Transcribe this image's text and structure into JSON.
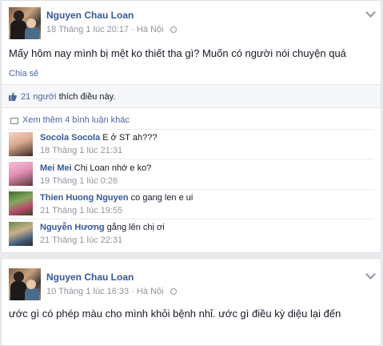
{
  "posts": [
    {
      "author": "Nguyen Chau Loan",
      "timestamp": "18 Tháng 1 lúc 20:17",
      "location": "Hà Nội",
      "text": "Mấy hôm nay mình bị mệt ko thiết tha gì? Muốn có người nói chuyện quá",
      "share_label": "Chia sẻ",
      "likes_count": "21 người",
      "likes_suffix": "thích điều này.",
      "more_comments": "Xem thêm 4 bình luận khác",
      "comments": [
        {
          "name": "Socola Socola",
          "text": "E ở ST ah???",
          "time": "18 Tháng 1 lúc 21:31"
        },
        {
          "name": "Mei Mei",
          "text": "Chị Loan nhớ e ko?",
          "time": "19 Tháng 1 lúc 0:26"
        },
        {
          "name": "Thien Huong Nguyen",
          "text": "co gang len e ui",
          "time": "21 Tháng 1 lúc 19:55"
        },
        {
          "name": "Nguyễn Hương",
          "text": "gắng lên chị ơi",
          "time": "21 Tháng 1 lúc 22:31"
        }
      ]
    },
    {
      "author": "Nguyen Chau Loan",
      "timestamp": "10 Tháng 1 lúc 16:33",
      "location": "Hà Nội",
      "text": "ước gì có phép màu cho mình khỏi bệnh nhỉ. ước gì điều kỳ diệu lại đến"
    }
  ],
  "colors": {
    "link": "#365899",
    "meta": "#90949c",
    "background": "#e9ebee"
  },
  "icons": [
    "avatar",
    "globe-icon",
    "chevron-down-icon",
    "thumbs-up-icon",
    "comment-icon"
  ]
}
